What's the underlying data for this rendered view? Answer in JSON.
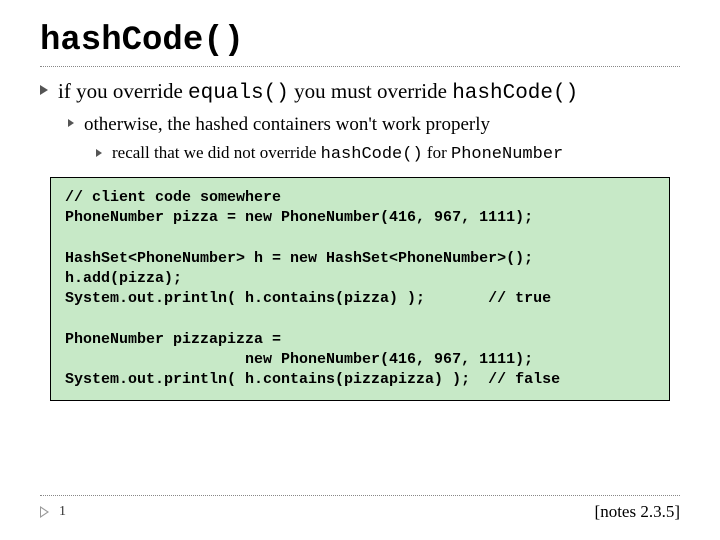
{
  "title": "hashCode()",
  "bullets": {
    "l0_pre": "if you override ",
    "l0_code1": "equals()",
    "l0_mid": " you must override ",
    "l0_code2": "hashCode()",
    "l1": "otherwise, the hashed containers won't work properly",
    "l2_pre": "recall that we did not override ",
    "l2_code1": "hashCode()",
    "l2_mid": " for ",
    "l2_code2": "PhoneNumber"
  },
  "code": "// client code somewhere\nPhoneNumber pizza = new PhoneNumber(416, 967, 1111);\n\nHashSet<PhoneNumber> h = new HashSet<PhoneNumber>();\nh.add(pizza);\nSystem.out.println( h.contains(pizza) );       // true\n\nPhoneNumber pizzapizza =\n                    new PhoneNumber(416, 967, 1111);\nSystem.out.println( h.contains(pizzapizza) );  // false",
  "footer": {
    "page": "1",
    "notes": "[notes 2.3.5]"
  }
}
